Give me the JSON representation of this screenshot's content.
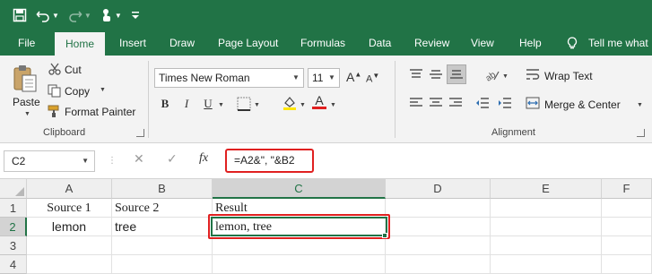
{
  "qat": {
    "save": "save-icon",
    "undo": "undo-icon",
    "redo": "redo-icon",
    "touch": "touch-mode-icon",
    "customize": "customize-icon"
  },
  "tabs": [
    "File",
    "Home",
    "Insert",
    "Draw",
    "Page Layout",
    "Formulas",
    "Data",
    "Review",
    "View",
    "Help",
    "Tell me what"
  ],
  "ribbon": {
    "clipboard": {
      "paste": "Paste",
      "cut": "Cut",
      "copy": "Copy",
      "format_painter": "Format Painter",
      "label": "Clipboard"
    },
    "font": {
      "name": "Times New Roman",
      "size": "11",
      "bold": "B",
      "italic": "I",
      "underline": "U",
      "font_color_letter": "A",
      "font_color": "#e02020",
      "fill_color": "#ffe600"
    },
    "alignment": {
      "wrap_text": "Wrap Text",
      "merge_center": "Merge & Center",
      "label": "Alignment"
    }
  },
  "formula_bar": {
    "name_box": "C2",
    "cancel": "✕",
    "enter": "✓",
    "fx": "fx",
    "formula": "=A2&\", \"&B2"
  },
  "sheet": {
    "columns": [
      "A",
      "B",
      "C",
      "D",
      "E",
      "F"
    ],
    "rows": [
      "1",
      "2",
      "3",
      "4"
    ],
    "cells": {
      "A1": "Source 1",
      "B1": "Source 2",
      "C1": "Result",
      "A2": "lemon",
      "B2": "tree",
      "C2": "lemon, tree"
    },
    "active_cell": "C2"
  },
  "colors": {
    "brand": "#217346",
    "highlight": "#e02020"
  }
}
